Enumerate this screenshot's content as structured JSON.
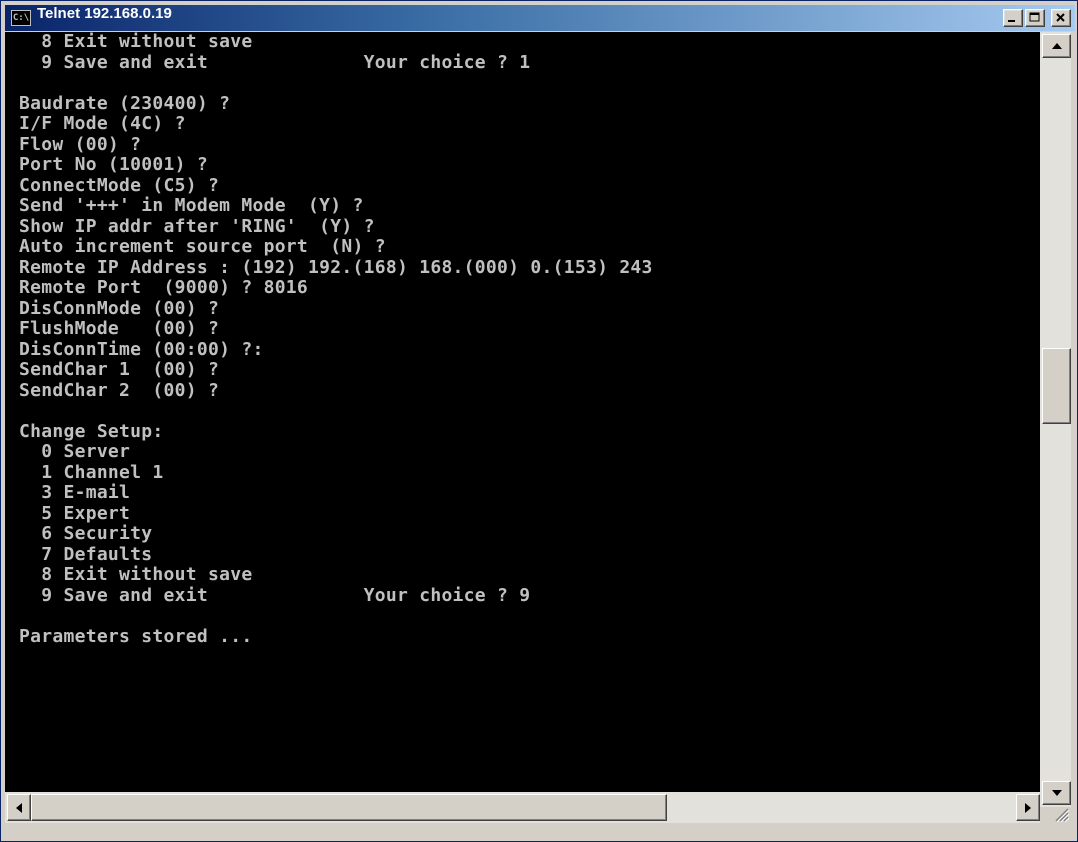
{
  "window": {
    "title": "Telnet 192.168.0.19",
    "system_icon": "console-icon",
    "system_icon_text": "C:\\",
    "controls": [
      "minimize-icon",
      "maximize-icon",
      "close-icon"
    ]
  },
  "console": {
    "foreground": "#c0c0c0",
    "background": "#000000",
    "lines": [
      "  8 Exit without save",
      "  9 Save and exit              Your choice ? 1",
      "",
      "Baudrate (230400) ?",
      "I/F Mode (4C) ?",
      "Flow (00) ?",
      "Port No (10001) ?",
      "ConnectMode (C5) ?",
      "Send '+++' in Modem Mode  (Y) ?",
      "Show IP addr after 'RING'  (Y) ?",
      "Auto increment source port  (N) ?",
      "Remote IP Address : (192) 192.(168) 168.(000) 0.(153) 243",
      "Remote Port  (9000) ? 8016",
      "DisConnMode (00) ?",
      "FlushMode   (00) ?",
      "DisConnTime (00:00) ?:",
      "SendChar 1  (00) ?",
      "SendChar 2  (00) ?",
      "",
      "Change Setup:",
      "  0 Server",
      "  1 Channel 1",
      "  3 E-mail",
      "  5 Expert",
      "  6 Security",
      "  7 Defaults",
      "  8 Exit without save",
      "  9 Save and exit              Your choice ? 9",
      "",
      "Parameters stored ..."
    ]
  },
  "scrollbars": {
    "vertical_icons": [
      "scroll-up-arrow-icon",
      "scroll-down-arrow-icon"
    ],
    "horizontal_icons": [
      "scroll-left-arrow-icon",
      "scroll-right-arrow-icon"
    ]
  }
}
